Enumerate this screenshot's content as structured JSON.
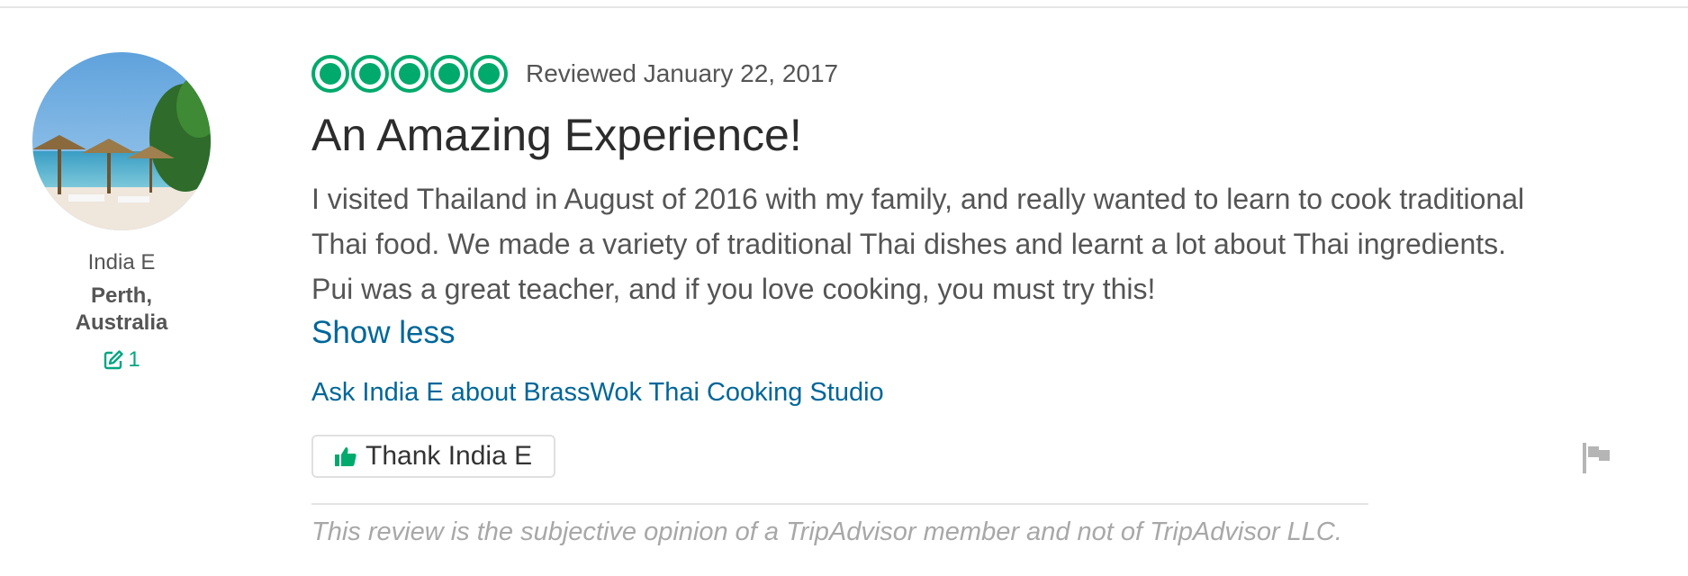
{
  "reviewer": {
    "name": "India E",
    "location": "Perth, Australia",
    "contributions": "1"
  },
  "review": {
    "rating": 5,
    "rating_max": 5,
    "date": "Reviewed January 22, 2017",
    "title": "An Amazing Experience!",
    "body": "I visited Thailand in August of 2016 with my family, and really wanted to learn to cook traditional Thai food. We made a variety of traditional Thai dishes and learnt a lot about Thai ingredients. Pui was a great teacher, and if you love cooking, you must try this!",
    "show_less_label": "Show less",
    "ask_label": "Ask India E about BrassWok Thai Cooking Studio",
    "thank_label": "Thank India E",
    "disclaimer": "This review is the subjective opinion of a TripAdvisor member and not of TripAdvisor LLC."
  },
  "colors": {
    "brand_green": "#00aa6c",
    "link_blue": "#006699",
    "text_gray": "#555555"
  },
  "icons": {
    "rating": "bubble-rating-icon",
    "contributions": "pencil-square-icon",
    "thank": "thumbs-up-icon",
    "report": "flag-icon"
  }
}
